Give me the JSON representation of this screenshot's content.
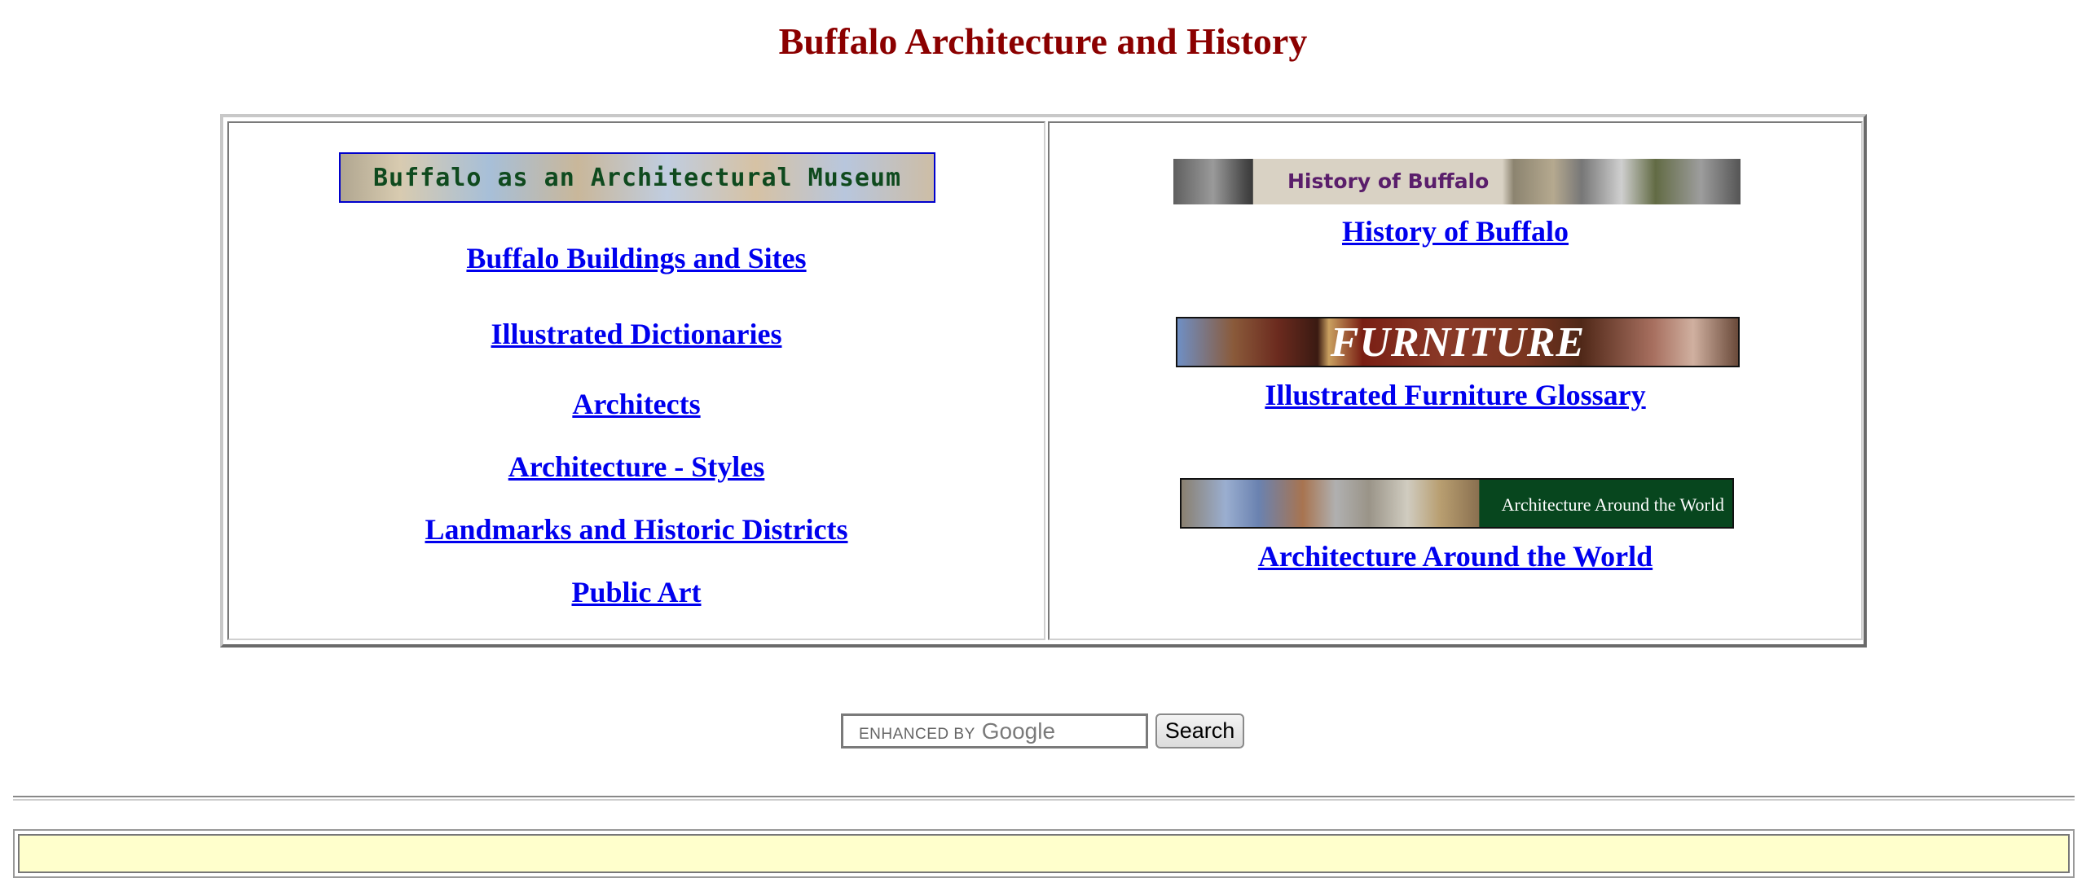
{
  "page": {
    "title": "Buffalo Architecture and History"
  },
  "left_cell": {
    "banner_label": "Buffalo as an Architectural Museum",
    "links": [
      "Buffalo Buildings and Sites",
      "Illustrated Dictionaries",
      "Architects",
      "Architecture - Styles",
      "Landmarks and Historic Districts",
      "Public Art"
    ]
  },
  "right_cell": {
    "history": {
      "banner_label": "History of Buffalo",
      "link": "History of Buffalo"
    },
    "furniture": {
      "banner_label": "FURNITURE",
      "link": "Illustrated Furniture Glossary"
    },
    "world": {
      "banner_label": "Architecture Around the World",
      "link": "Architecture Around the World"
    }
  },
  "search": {
    "placeholder_small": "ENHANCED BY",
    "placeholder_brand": "Google",
    "button_label": "Search"
  },
  "colors": {
    "title": "#8b0000",
    "link": "#0000ee",
    "footer_background": "#ffffcc"
  }
}
